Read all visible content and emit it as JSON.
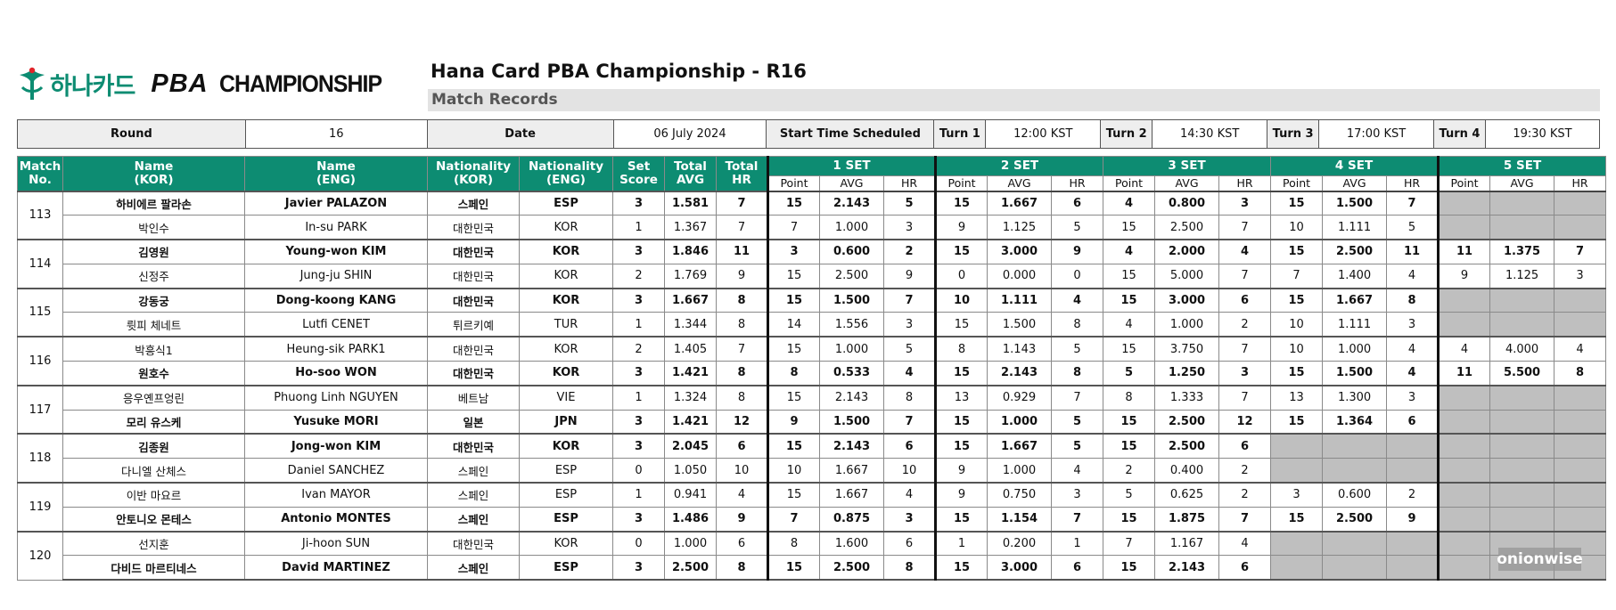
{
  "logo": {
    "korean": "하나카드",
    "pba": "PBA",
    "champ": "CHAMPIONSHIP"
  },
  "title": "Hana Card PBA Championship - R16",
  "subtitle": "Match Records",
  "info": {
    "round_label": "Round",
    "round": "16",
    "date_label": "Date",
    "date": "06 July 2024",
    "start_label": "Start Time Scheduled",
    "turns": [
      {
        "label": "Turn 1",
        "time": "12:00 KST"
      },
      {
        "label": "Turn 2",
        "time": "14:30 KST"
      },
      {
        "label": "Turn 3",
        "time": "17:00 KST"
      },
      {
        "label": "Turn 4",
        "time": "19:30 KST"
      }
    ]
  },
  "headers": {
    "match": [
      "Match",
      "No."
    ],
    "name_kor": [
      "Name",
      "(KOR)"
    ],
    "name_eng": [
      "Name",
      "(ENG)"
    ],
    "nat_kor": [
      "Nationality",
      "(KOR)"
    ],
    "nat_eng": [
      "Nationality",
      "(ENG)"
    ],
    "set_score": [
      "Set",
      "Score"
    ],
    "total_avg": [
      "Total",
      "AVG"
    ],
    "total_hr": [
      "Total",
      "HR"
    ],
    "sets": [
      "1 SET",
      "2 SET",
      "3 SET",
      "4 SET",
      "5 SET"
    ],
    "sub": [
      "Point",
      "AVG",
      "HR"
    ]
  },
  "matches": [
    {
      "no": "113",
      "players": [
        {
          "win": true,
          "kor": "하비에르 팔라손",
          "eng": "Javier PALAZON",
          "nat_kor": "스페인",
          "nat_eng": "ESP",
          "score": "3",
          "avg": "1.581",
          "hr": "7",
          "sets": [
            [
              "15",
              "2.143",
              "5"
            ],
            [
              "15",
              "1.667",
              "6"
            ],
            [
              "4",
              "0.800",
              "3"
            ],
            [
              "15",
              "1.500",
              "7"
            ],
            null
          ]
        },
        {
          "win": false,
          "kor": "박인수",
          "eng": "In-su PARK",
          "nat_kor": "대한민국",
          "nat_eng": "KOR",
          "score": "1",
          "avg": "1.367",
          "hr": "7",
          "sets": [
            [
              "7",
              "1.000",
              "3"
            ],
            [
              "9",
              "1.125",
              "5"
            ],
            [
              "15",
              "2.500",
              "7"
            ],
            [
              "10",
              "1.111",
              "5"
            ],
            null
          ]
        }
      ]
    },
    {
      "no": "114",
      "players": [
        {
          "win": true,
          "kor": "김영원",
          "eng": "Young-won KIM",
          "nat_kor": "대한민국",
          "nat_eng": "KOR",
          "score": "3",
          "avg": "1.846",
          "hr": "11",
          "sets": [
            [
              "3",
              "0.600",
              "2"
            ],
            [
              "15",
              "3.000",
              "9"
            ],
            [
              "4",
              "2.000",
              "4"
            ],
            [
              "15",
              "2.500",
              "11"
            ],
            [
              "11",
              "1.375",
              "7"
            ]
          ]
        },
        {
          "win": false,
          "kor": "신정주",
          "eng": "Jung-ju SHIN",
          "nat_kor": "대한민국",
          "nat_eng": "KOR",
          "score": "2",
          "avg": "1.769",
          "hr": "9",
          "sets": [
            [
              "15",
              "2.500",
              "9"
            ],
            [
              "0",
              "0.000",
              "0"
            ],
            [
              "15",
              "5.000",
              "7"
            ],
            [
              "7",
              "1.400",
              "4"
            ],
            [
              "9",
              "1.125",
              "3"
            ]
          ]
        }
      ]
    },
    {
      "no": "115",
      "players": [
        {
          "win": true,
          "kor": "강동궁",
          "eng": "Dong-koong KANG",
          "nat_kor": "대한민국",
          "nat_eng": "KOR",
          "score": "3",
          "avg": "1.667",
          "hr": "8",
          "sets": [
            [
              "15",
              "1.500",
              "7"
            ],
            [
              "10",
              "1.111",
              "4"
            ],
            [
              "15",
              "3.000",
              "6"
            ],
            [
              "15",
              "1.667",
              "8"
            ],
            null
          ]
        },
        {
          "win": false,
          "kor": "륏피 체네트",
          "eng": "Lutfi CENET",
          "nat_kor": "튀르키예",
          "nat_eng": "TUR",
          "score": "1",
          "avg": "1.344",
          "hr": "8",
          "sets": [
            [
              "14",
              "1.556",
              "3"
            ],
            [
              "15",
              "1.500",
              "8"
            ],
            [
              "4",
              "1.000",
              "2"
            ],
            [
              "10",
              "1.111",
              "3"
            ],
            null
          ]
        }
      ]
    },
    {
      "no": "116",
      "players": [
        {
          "win": false,
          "kor": "박흥식1",
          "eng": "Heung-sik PARK1",
          "nat_kor": "대한민국",
          "nat_eng": "KOR",
          "score": "2",
          "avg": "1.405",
          "hr": "7",
          "sets": [
            [
              "15",
              "1.000",
              "5"
            ],
            [
              "8",
              "1.143",
              "5"
            ],
            [
              "15",
              "3.750",
              "7"
            ],
            [
              "10",
              "1.000",
              "4"
            ],
            [
              "4",
              "4.000",
              "4"
            ]
          ]
        },
        {
          "win": true,
          "kor": "원호수",
          "eng": "Ho-soo WON",
          "nat_kor": "대한민국",
          "nat_eng": "KOR",
          "score": "3",
          "avg": "1.421",
          "hr": "8",
          "sets": [
            [
              "8",
              "0.533",
              "4"
            ],
            [
              "15",
              "2.143",
              "8"
            ],
            [
              "5",
              "1.250",
              "3"
            ],
            [
              "15",
              "1.500",
              "4"
            ],
            [
              "11",
              "5.500",
              "8"
            ]
          ]
        }
      ]
    },
    {
      "no": "117",
      "players": [
        {
          "win": false,
          "kor": "응우옌프엉린",
          "eng": "Phuong Linh NGUYEN",
          "nat_kor": "베트남",
          "nat_eng": "VIE",
          "score": "1",
          "avg": "1.324",
          "hr": "8",
          "sets": [
            [
              "15",
              "2.143",
              "8"
            ],
            [
              "13",
              "0.929",
              "7"
            ],
            [
              "8",
              "1.333",
              "7"
            ],
            [
              "13",
              "1.300",
              "3"
            ],
            null
          ]
        },
        {
          "win": true,
          "kor": "모리 유스케",
          "eng": "Yusuke MORI",
          "nat_kor": "일본",
          "nat_eng": "JPN",
          "score": "3",
          "avg": "1.421",
          "hr": "12",
          "sets": [
            [
              "9",
              "1.500",
              "7"
            ],
            [
              "15",
              "1.000",
              "5"
            ],
            [
              "15",
              "2.500",
              "12"
            ],
            [
              "15",
              "1.364",
              "6"
            ],
            null
          ]
        }
      ]
    },
    {
      "no": "118",
      "players": [
        {
          "win": true,
          "kor": "김종원",
          "eng": "Jong-won KIM",
          "nat_kor": "대한민국",
          "nat_eng": "KOR",
          "score": "3",
          "avg": "2.045",
          "hr": "6",
          "sets": [
            [
              "15",
              "2.143",
              "6"
            ],
            [
              "15",
              "1.667",
              "5"
            ],
            [
              "15",
              "2.500",
              "6"
            ],
            null,
            null
          ]
        },
        {
          "win": false,
          "kor": "다니엘 산체스",
          "eng": "Daniel SANCHEZ",
          "nat_kor": "스페인",
          "nat_eng": "ESP",
          "score": "0",
          "avg": "1.050",
          "hr": "10",
          "sets": [
            [
              "10",
              "1.667",
              "10"
            ],
            [
              "9",
              "1.000",
              "4"
            ],
            [
              "2",
              "0.400",
              "2"
            ],
            null,
            null
          ]
        }
      ]
    },
    {
      "no": "119",
      "players": [
        {
          "win": false,
          "kor": "이반 마요르",
          "eng": "Ivan MAYOR",
          "nat_kor": "스페인",
          "nat_eng": "ESP",
          "score": "1",
          "avg": "0.941",
          "hr": "4",
          "sets": [
            [
              "15",
              "1.667",
              "4"
            ],
            [
              "9",
              "0.750",
              "3"
            ],
            [
              "5",
              "0.625",
              "2"
            ],
            [
              "3",
              "0.600",
              "2"
            ],
            null
          ]
        },
        {
          "win": true,
          "kor": "안토니오 몬테스",
          "eng": "Antonio MONTES",
          "nat_kor": "스페인",
          "nat_eng": "ESP",
          "score": "3",
          "avg": "1.486",
          "hr": "9",
          "sets": [
            [
              "7",
              "0.875",
              "3"
            ],
            [
              "15",
              "1.154",
              "7"
            ],
            [
              "15",
              "1.875",
              "7"
            ],
            [
              "15",
              "2.500",
              "9"
            ],
            null
          ]
        }
      ]
    },
    {
      "no": "120",
      "players": [
        {
          "win": false,
          "kor": "선지훈",
          "eng": "Ji-hoon SUN",
          "nat_kor": "대한민국",
          "nat_eng": "KOR",
          "score": "0",
          "avg": "1.000",
          "hr": "6",
          "sets": [
            [
              "8",
              "1.600",
              "6"
            ],
            [
              "1",
              "0.200",
              "1"
            ],
            [
              "7",
              "1.167",
              "4"
            ],
            null,
            null
          ]
        },
        {
          "win": true,
          "kor": "다비드 마르티네스",
          "eng": "David MARTINEZ",
          "nat_kor": "스페인",
          "nat_eng": "ESP",
          "score": "3",
          "avg": "2.500",
          "hr": "8",
          "sets": [
            [
              "15",
              "2.500",
              "8"
            ],
            [
              "15",
              "3.000",
              "6"
            ],
            [
              "15",
              "2.143",
              "6"
            ],
            null,
            null
          ]
        }
      ]
    }
  ],
  "watermark": "onionwise",
  "colors": {
    "header_green": "#0d8c72",
    "empty_gray": "#bfbfbf",
    "subtitle_bg": "#e3e3e3"
  }
}
